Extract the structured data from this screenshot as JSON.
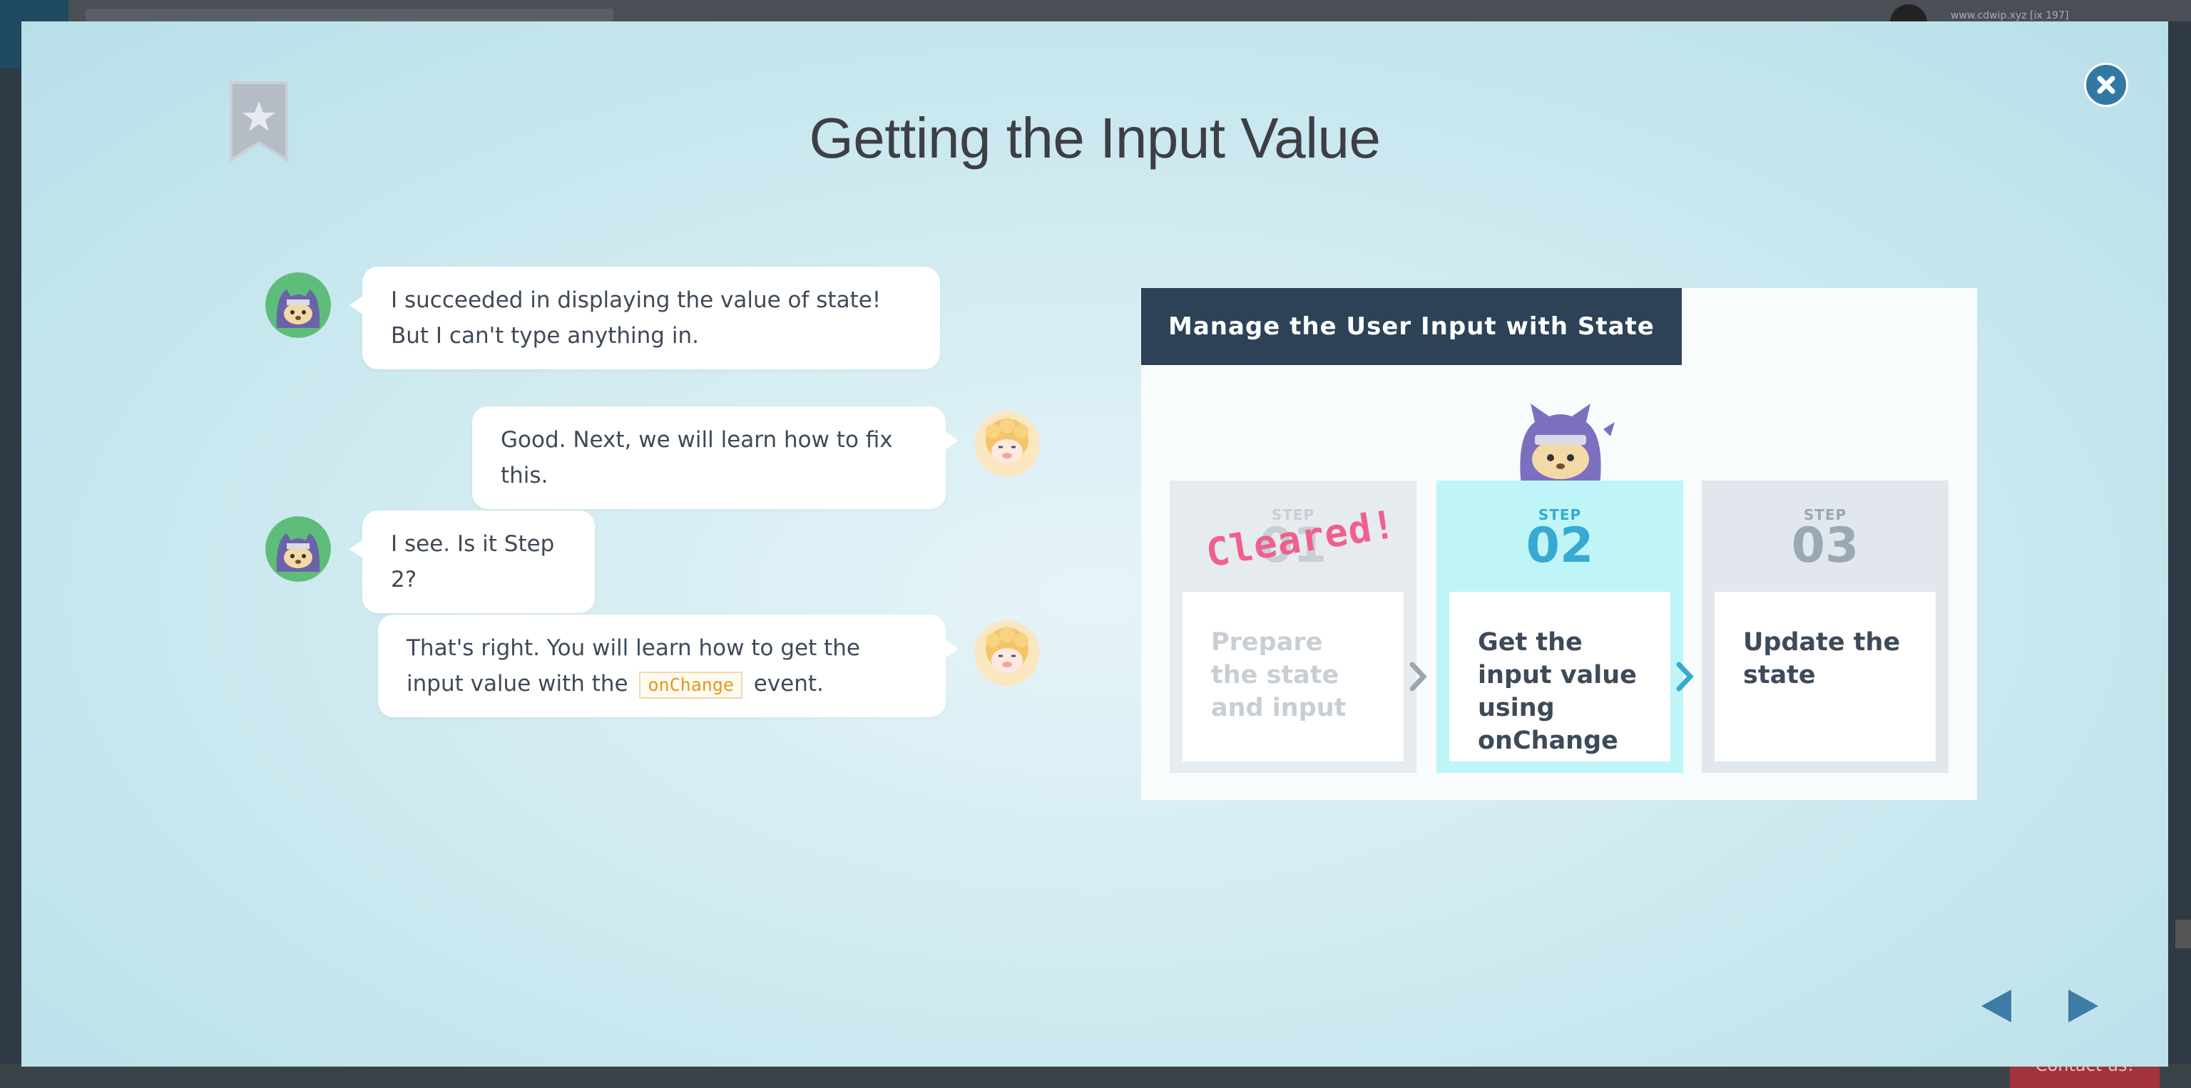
{
  "background": {
    "url_text": "www.cdwip.xyz [ix 197]",
    "contact_label": "Contact us!"
  },
  "modal": {
    "title": "Getting the Input Value",
    "icons": {
      "bookmark": "bookmark-star-icon",
      "close": "close-icon",
      "prev": "prev-arrow-icon",
      "next": "next-arrow-icon"
    }
  },
  "chat": [
    {
      "speaker": "ninja-cat",
      "side": "left",
      "text": "I succeeded in displaying the value of state! But I can't type anything in."
    },
    {
      "speaker": "sheep",
      "side": "right",
      "text": "Good. Next, we will learn how to fix this."
    },
    {
      "speaker": "ninja-cat",
      "side": "left",
      "text": "I see. Is it Step 2?"
    },
    {
      "speaker": "sheep",
      "side": "right",
      "text_before": "That's right. You will learn how to get the input value with the ",
      "code": "onChange",
      "text_after": " event."
    }
  ],
  "card": {
    "header": "Manage the User Input with State",
    "cleared_stamp": "Cleared!",
    "steps": [
      {
        "label": "STEP",
        "number": "01",
        "text": "Prepare the state and input",
        "status": "cleared"
      },
      {
        "label": "STEP",
        "number": "02",
        "text": "Get the input value using onChange",
        "status": "current"
      },
      {
        "label": "STEP",
        "number": "03",
        "text": "Update the state",
        "status": "upcoming"
      }
    ]
  },
  "colors": {
    "header_bg": "#2d4256",
    "current_step_bg": "#bff5f6",
    "accent_blue": "#37a9d2",
    "cleared_pink": "#f0608d",
    "close_button": "#3378a3"
  }
}
